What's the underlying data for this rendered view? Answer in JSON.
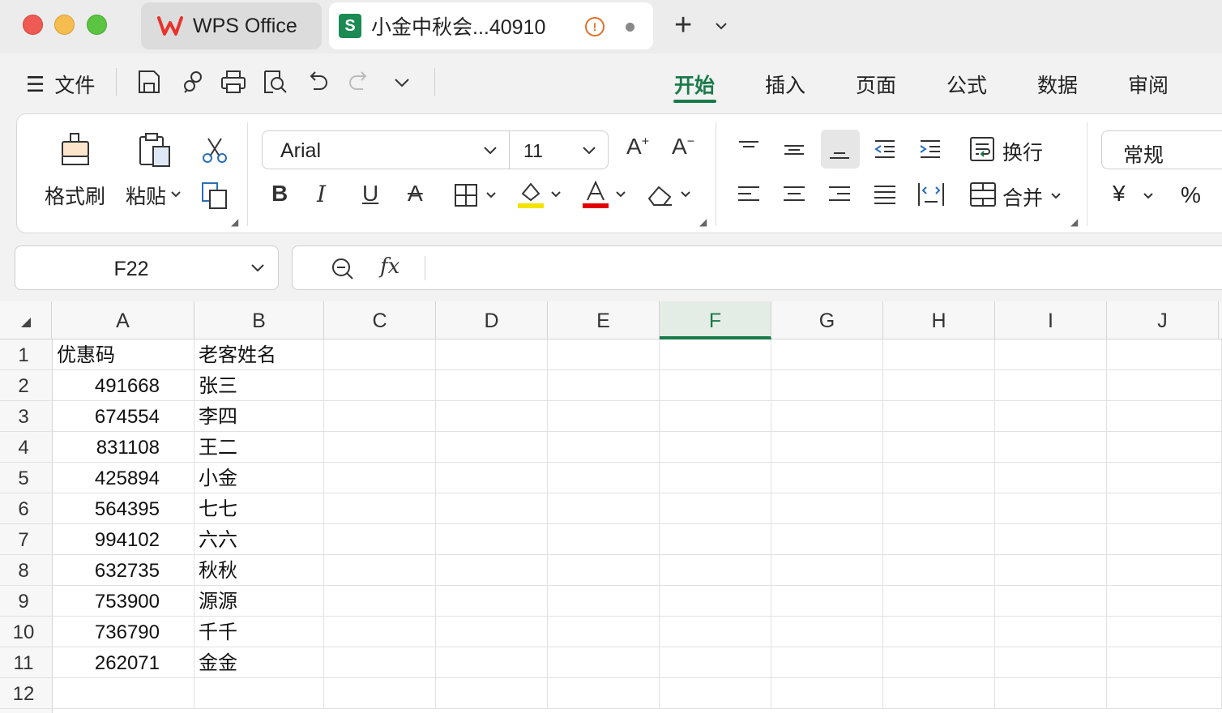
{
  "titlebar": {
    "home_tab_label": "WPS Office",
    "doc_tab_label": "小金中秋会...40910",
    "doc_tab_badge": "S"
  },
  "quickbar": {
    "file_menu_label": "文件",
    "ribbon_tabs": [
      "开始",
      "插入",
      "页面",
      "公式",
      "数据",
      "审阅"
    ],
    "active_tab": "开始"
  },
  "ribbon": {
    "format_painter_label": "格式刷",
    "paste_label": "粘贴",
    "font_name": "Arial",
    "font_size": "11",
    "wrap_text_label": "换行",
    "merge_label": "合并",
    "number_format": "常规",
    "currency_symbol": "¥",
    "percent_symbol": "%",
    "colors": {
      "fill_color": "#f4e300",
      "font_color": "#e30000",
      "accent": "#1a7a4a"
    }
  },
  "formula_bar": {
    "cell_reference": "F22",
    "fx_label": "fx",
    "formula_value": ""
  },
  "sheet": {
    "columns": [
      "A",
      "B",
      "C",
      "D",
      "E",
      "F",
      "G",
      "H",
      "I",
      "J"
    ],
    "selected_column": "F",
    "rows": [
      {
        "num": "1",
        "a": "优惠码",
        "b": "老客姓名"
      },
      {
        "num": "2",
        "a": "491668",
        "b": "张三"
      },
      {
        "num": "3",
        "a": "674554",
        "b": "李四"
      },
      {
        "num": "4",
        "a": "831108",
        "b": "王二"
      },
      {
        "num": "5",
        "a": "425894",
        "b": "小金"
      },
      {
        "num": "6",
        "a": "564395",
        "b": "七七"
      },
      {
        "num": "7",
        "a": "994102",
        "b": "六六"
      },
      {
        "num": "8",
        "a": "632735",
        "b": "秋秋"
      },
      {
        "num": "9",
        "a": "753900",
        "b": "源源"
      },
      {
        "num": "10",
        "a": "736790",
        "b": "千千"
      },
      {
        "num": "11",
        "a": "262071",
        "b": "金金"
      },
      {
        "num": "12",
        "a": "",
        "b": ""
      }
    ]
  }
}
